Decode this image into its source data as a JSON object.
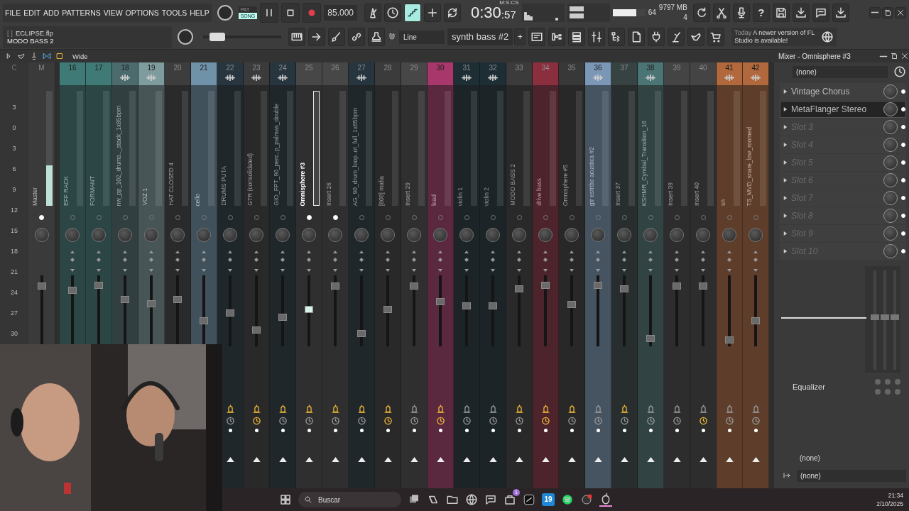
{
  "menu": [
    "FILE",
    "EDIT",
    "ADD",
    "PATTERNS",
    "VIEW",
    "OPTIONS",
    "TOOLS",
    "HELP"
  ],
  "transport": {
    "modes": [
      {
        "label": "PAT",
        "selected": false
      },
      {
        "label": "SONG",
        "selected": true
      }
    ],
    "tempo": "85.000",
    "time_format": "M:S:CS",
    "time": "0:30",
    "time_cs": ":57"
  },
  "toggles": [
    {
      "on": false
    },
    {
      "on": false
    },
    {
      "on": true
    },
    {
      "on": false
    },
    {
      "on": false
    }
  ],
  "stats": {
    "cpu": "64",
    "cpu_meter": {
      "level": 0.72
    },
    "memory": "9797 MB",
    "polyphony": "4"
  },
  "help": "?",
  "project": {
    "bracket": "[  ]",
    "file": "ECLIPSE.flp",
    "hint": "MODO BASS 2"
  },
  "main_slider": {
    "level": 0.1
  },
  "snap": "Line",
  "pattern": {
    "name": "synth bass #2",
    "add": "+"
  },
  "news": {
    "when": "Today",
    "text": "A newer version of FL Studio is available!"
  },
  "view_mode": "Wide",
  "mixer_title": "Mixer - Omnisphere #3",
  "scale": {
    "header": "C",
    "labels": [
      "3",
      "0",
      "3",
      "6",
      "9",
      "12",
      "15",
      "18",
      "21",
      "24",
      "27",
      "30"
    ]
  },
  "master": {
    "header": "M",
    "name": "Master",
    "fader": {
      "level": 0.89
    },
    "meter": {
      "level": 0.35
    }
  },
  "strips": [
    {
      "number": "16",
      "name": "EFF RACK",
      "color": "#3f7a76",
      "fx": false,
      "dot_lit": false,
      "selected": false,
      "level": 0.82
    },
    {
      "number": "17",
      "name": "FORMANT",
      "color": "#3f7a76",
      "fx": false,
      "dot_lit": false,
      "selected": false,
      "level": 0.9
    },
    {
      "number": "18",
      "name": "nw_pp_102_drums.._stack_1x85bpm",
      "color": "#4c6b6d",
      "fx": true,
      "dot_lit": false,
      "selected": false,
      "level": 0.67
    },
    {
      "number": "19",
      "name": "VOZ 1",
      "color": "#7e9b9d",
      "fx": true,
      "dot_lit": false,
      "selected": false,
      "level": 0.6
    },
    {
      "number": "20",
      "name": "HAT CLOSED 4",
      "color": "#3d3d3d",
      "fx": false,
      "dot_lit": false,
      "selected": false,
      "level": 0.67
    },
    {
      "number": "21",
      "name": "cello",
      "color": "#6f92a9",
      "fx": false,
      "dot_lit": false,
      "selected": false,
      "level": 0.32
    },
    {
      "number": "22",
      "name": "DRUMS PUTA",
      "color": "#27353f",
      "fx": true,
      "dot_lit": false,
      "selected": false,
      "level": 0.47,
      "send_lit": true,
      "clock_lit": false
    },
    {
      "number": "23",
      "name": "GTR (consolidated)",
      "color": "#3b3b3b",
      "fx": true,
      "dot_lit": false,
      "selected": false,
      "level": 0.2,
      "send_lit": true,
      "clock_lit": true
    },
    {
      "number": "24",
      "name": "GIO_FPT_90_perc..p_palmas_double",
      "color": "#27353f",
      "fx": true,
      "dot_lit": false,
      "selected": false,
      "level": 0.4,
      "send_lit": true,
      "clock_lit": false
    },
    {
      "number": "25",
      "name": "Omnisphere #3",
      "color": "#474747",
      "fx": false,
      "dot_lit": true,
      "selected": true,
      "level": 0.52,
      "send_lit": true,
      "clock_lit": false
    },
    {
      "number": "26",
      "name": "Insert 26",
      "color": "#474747",
      "fx": false,
      "dot_lit": true,
      "selected": false,
      "level": 0.89,
      "send_lit": true,
      "clock_lit": false
    },
    {
      "number": "27",
      "name": "AG_90_drum_loop..ot_full_1x85bpm",
      "color": "#27353f",
      "fx": true,
      "dot_lit": false,
      "selected": false,
      "level": 0.14,
      "send_lit": true,
      "clock_lit": false
    },
    {
      "number": "28",
      "name": "[808] mafia",
      "color": "#3b3b3b",
      "fx": false,
      "dot_lit": false,
      "selected": false,
      "level": 0.52,
      "send_lit": true,
      "clock_lit": true
    },
    {
      "number": "29",
      "name": "Insert 29",
      "color": "#474747",
      "fx": false,
      "dot_lit": false,
      "selected": false,
      "level": 0.89,
      "send_lit": false,
      "clock_lit": false
    },
    {
      "number": "30",
      "name": "lead",
      "color": "#a8386b",
      "fx": false,
      "dot_lit": false,
      "selected": false,
      "level": 0.64,
      "send_lit": true,
      "clock_lit": true
    },
    {
      "number": "31",
      "name": "violin 1",
      "color": "#1d2e35",
      "fx": true,
      "dot_lit": false,
      "selected": false,
      "level": 0.58,
      "send_lit": false,
      "clock_lit": false
    },
    {
      "number": "32",
      "name": "violin 2",
      "color": "#1d2e35",
      "fx": true,
      "dot_lit": false,
      "selected": false,
      "level": 0.58,
      "send_lit": false,
      "clock_lit": false
    },
    {
      "number": "33",
      "name": "MODO BASS 2",
      "color": "#3b3b3b",
      "fx": false,
      "dot_lit": false,
      "selected": false,
      "level": 0.85,
      "send_lit": true,
      "clock_lit": false
    },
    {
      "number": "34",
      "name": "drive bass",
      "color": "#8b2f3e",
      "fx": false,
      "dot_lit": false,
      "selected": false,
      "level": 0.9,
      "send_lit": true,
      "clock_lit": true
    },
    {
      "number": "35",
      "name": "Omnisphere #5",
      "color": "#383838",
      "fx": false,
      "dot_lit": false,
      "selected": false,
      "level": 0.6,
      "send_lit": true,
      "clock_lit": false
    },
    {
      "number": "36",
      "name": "gtr estribo acustica #2",
      "color": "#7a98b6",
      "fx": true,
      "dot_lit": false,
      "selected": false,
      "level": 0.9,
      "send_lit": false,
      "clock_lit": false
    },
    {
      "number": "37",
      "name": "Insert 37",
      "color": "#374243",
      "fx": false,
      "dot_lit": false,
      "selected": false,
      "level": 0.84,
      "send_lit": true,
      "clock_lit": false
    },
    {
      "number": "38",
      "name": "KSHMR_Cymbal_Transition_16",
      "color": "#4b7574",
      "fx": true,
      "dot_lit": false,
      "selected": false,
      "level": 0.07,
      "send_lit": false,
      "clock_lit": false
    },
    {
      "number": "39",
      "name": "Insert 39",
      "color": "#444444",
      "fx": false,
      "dot_lit": false,
      "selected": false,
      "level": 0.89,
      "send_lit": false,
      "clock_lit": false
    },
    {
      "number": "40",
      "name": "Insert 40",
      "color": "#444444",
      "fx": false,
      "dot_lit": false,
      "selected": false,
      "level": 0.89,
      "send_lit": false,
      "clock_lit": true
    },
    {
      "number": "41",
      "name": "sn",
      "color": "#b0683c",
      "fx": true,
      "dot_lit": false,
      "selected": false,
      "level": 0.04,
      "send_lit": false,
      "clock_lit": false
    },
    {
      "number": "42",
      "name": "TS_MVD_snare_low_roomed",
      "color": "#b0683c",
      "fx": true,
      "dot_lit": false,
      "selected": false,
      "level": 0.35,
      "send_lit": false,
      "clock_lit": false
    }
  ],
  "panel": {
    "preset": "(none)",
    "slots": [
      {
        "name": "Vintage Chorus",
        "filled": true,
        "selected": false
      },
      {
        "name": "MetaFlanger Stereo",
        "filled": true,
        "selected": true
      },
      {
        "name": "Slot 3",
        "filled": false,
        "selected": false
      },
      {
        "name": "Slot 4",
        "filled": false,
        "selected": false
      },
      {
        "name": "Slot 5",
        "filled": false,
        "selected": false
      },
      {
        "name": "Slot 6",
        "filled": false,
        "selected": false
      },
      {
        "name": "Slot 7",
        "filled": false,
        "selected": false
      },
      {
        "name": "Slot 8",
        "filled": false,
        "selected": false
      },
      {
        "name": "Slot 9",
        "filled": false,
        "selected": false
      },
      {
        "name": "Slot 10",
        "filled": false,
        "selected": false
      }
    ],
    "eq_label": "Equalizer",
    "input": "(none)",
    "output": "(none)"
  },
  "taskbar": {
    "search": "Buscar",
    "badge": "1",
    "app_text": "19",
    "time": "21:34",
    "date": "2/10/2025"
  }
}
